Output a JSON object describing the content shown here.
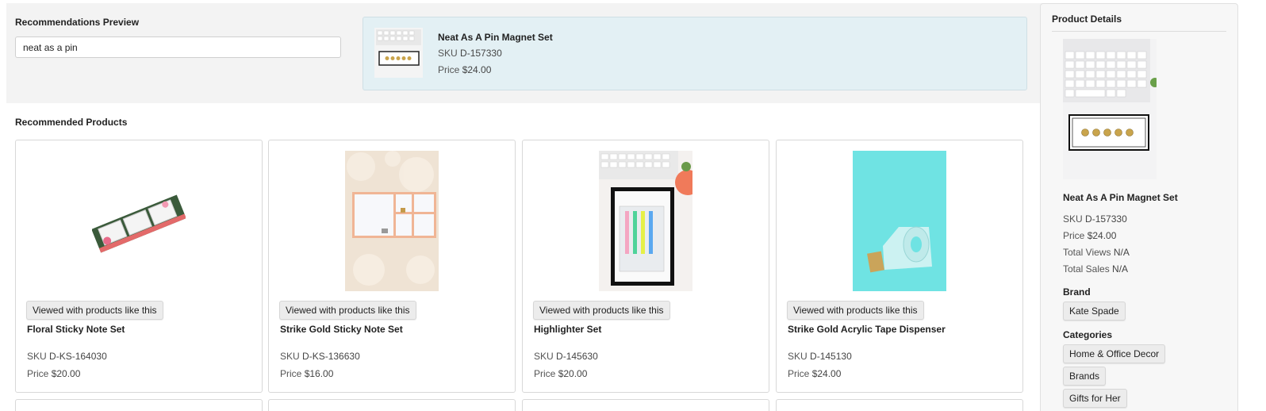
{
  "preview": {
    "title": "Recommendations Preview",
    "search_value": "neat as a pin",
    "selected": {
      "name": "Neat As A Pin Magnet Set",
      "sku_label": "SKU",
      "sku": "D-157330",
      "price_label": "Price",
      "price": "$24.00"
    }
  },
  "recommended": {
    "title": "Recommended Products",
    "products": [
      {
        "chip": "Viewed with products like this",
        "name": "Floral Sticky Note Set",
        "sku_label": "SKU",
        "sku": "D-KS-164030",
        "price_label": "Price",
        "price": "$20.00"
      },
      {
        "chip": "Viewed with products like this",
        "name": "Strike Gold Sticky Note Set",
        "sku_label": "SKU",
        "sku": "D-KS-136630",
        "price_label": "Price",
        "price": "$16.00"
      },
      {
        "chip": "Viewed with products like this",
        "name": "Highlighter Set",
        "sku_label": "SKU",
        "sku": "D-145630",
        "price_label": "Price",
        "price": "$20.00"
      },
      {
        "chip": "Viewed with products like this",
        "name": "Strike Gold Acrylic Tape Dispenser",
        "sku_label": "SKU",
        "sku": "D-145130",
        "price_label": "Price",
        "price": "$24.00"
      }
    ]
  },
  "details": {
    "title": "Product Details",
    "name": "Neat As A Pin Magnet Set",
    "sku_label": "SKU",
    "sku": "D-157330",
    "price_label": "Price",
    "price": "$24.00",
    "views_label": "Total Views",
    "views": "N/A",
    "sales_label": "Total Sales",
    "sales": "N/A",
    "brand_heading": "Brand",
    "brand": "Kate Spade",
    "categories_heading": "Categories",
    "categories": [
      "Home & Office Decor",
      "Brands",
      "Gifts for Her"
    ]
  },
  "colors": {
    "selected_card_bg": "#e3f0f4",
    "teal_product_bg": "#6fe3e3"
  }
}
